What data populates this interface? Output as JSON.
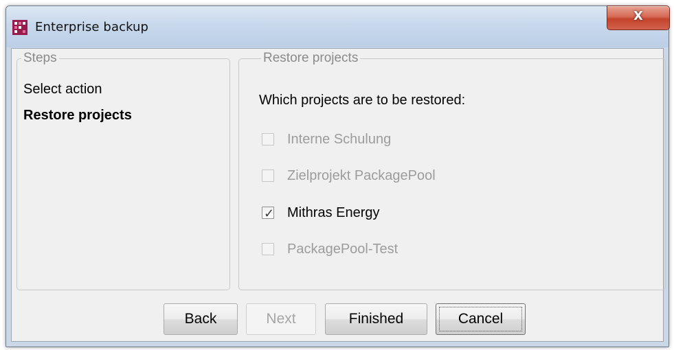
{
  "window": {
    "title": "Enterprise backup",
    "close_label": "X"
  },
  "steps": {
    "legend": "Steps",
    "items": [
      {
        "label": "Select action",
        "active": false
      },
      {
        "label": "Restore projects",
        "active": true
      }
    ]
  },
  "restore": {
    "legend": "Restore projects",
    "question": "Which projects are to be restored:",
    "projects": [
      {
        "label": "Interne Schulung",
        "checked": false,
        "enabled": false
      },
      {
        "label": "Zielprojekt PackagePool",
        "checked": false,
        "enabled": false
      },
      {
        "label": "Mithras Energy",
        "checked": true,
        "enabled": true
      },
      {
        "label": "PackagePool-Test",
        "checked": false,
        "enabled": false
      }
    ]
  },
  "buttons": {
    "back": "Back",
    "next": "Next",
    "finished": "Finished",
    "cancel": "Cancel"
  },
  "colors": {
    "app_icon": "#9a1a4e",
    "close_button": "#c4432c",
    "disabled_text": "#9c9c9c"
  },
  "icons": {
    "app": "app-logo-icon",
    "close": "close-icon",
    "check": "checkmark-icon"
  }
}
